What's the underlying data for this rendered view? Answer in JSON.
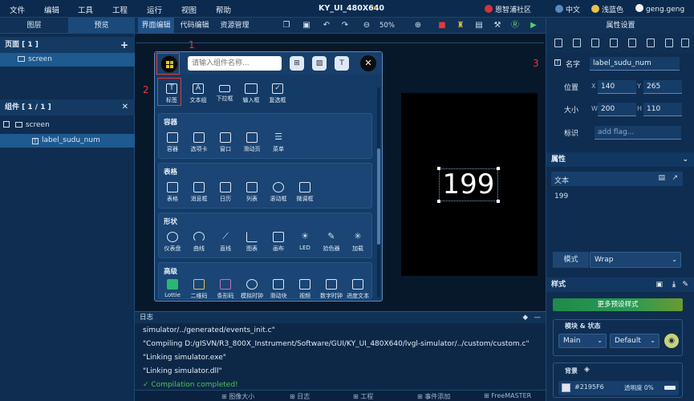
{
  "menu": {
    "items": [
      "文件",
      "编辑",
      "工具",
      "工程",
      "运行",
      "视图",
      "帮助"
    ],
    "title": "KY_UI_480X640",
    "community": "恩智浦社区",
    "language": "中文",
    "theme": "浅蓝色",
    "user": "geng.geng"
  },
  "toolbar": {
    "zoom": "50%",
    "tabs": [
      "界面编辑",
      "代码编辑",
      "资源管理"
    ]
  },
  "left": {
    "tabs": [
      "图层",
      "预览"
    ],
    "pages_header": "页面 [ 1 ]",
    "pages": [
      "screen"
    ],
    "components_header": "组件 [ 1 / 1 ]",
    "tree_root": "screen",
    "tree_child": "label_sudu_num"
  },
  "palette": {
    "search_placeholder": "请输入组件名称...",
    "top_widgets": [
      "标签",
      "文本组",
      "下拉框",
      "输入框",
      "复选框"
    ],
    "sections": [
      {
        "title": "容器",
        "items": [
          "容器",
          "选项卡",
          "窗口",
          "滑动页",
          "菜单"
        ]
      },
      {
        "title": "表格",
        "items": [
          "表格",
          "消息框",
          "日历",
          "列表",
          "滚动框",
          "微调框"
        ]
      },
      {
        "title": "形状",
        "items": [
          "仪表盘",
          "曲线",
          "直线",
          "图表",
          "画布",
          "LED",
          "拾色器",
          "加载"
        ]
      },
      {
        "title": "高级",
        "items": [
          "Lottie",
          "二维码",
          "条形码",
          "模拟时钟",
          "滑动块",
          "视频",
          "数字时钟",
          "进度文本"
        ]
      }
    ],
    "annotations": [
      "1",
      "2",
      "3"
    ]
  },
  "preview": {
    "label_text": "199"
  },
  "log": {
    "title": "日志",
    "lines": [
      "simulator/../generated/events_init.c\"",
      "\"Compiling D:/gISVN/R3_800X_Instrument/Software/GUI/KY_UI_480X640/lvgl-simulator/../custom/custom.c\"",
      "\"Linking simulator.exe\"",
      "\"Linking simulator.dll\"",
      "✓ Compilation completed!"
    ]
  },
  "status": {
    "items": [
      "图像大小",
      "日志",
      "工程",
      "事件添加",
      "FreeMASTER"
    ]
  },
  "properties": {
    "title": "属性设置",
    "name_label": "名字",
    "name_value": "label_sudu_num",
    "pos_label": "位置",
    "x": "140",
    "y": "265",
    "size_label": "大小",
    "w": "200",
    "h": "110",
    "flag_label": "标识",
    "flag_placeholder": "add flag...",
    "attr_header": "属性",
    "text_label": "文本",
    "text_value": "199",
    "mode_label": "模式",
    "mode_value": "Wrap",
    "style_header": "样式",
    "more_styles": "更多预设样式",
    "part_state": "模块 & 状态",
    "part_value": "Main",
    "state_value": "Default",
    "bg_label": "背景",
    "bg_color": "#2195F6",
    "opacity_label": "透明度 0%"
  },
  "colors": {
    "accent": "#2195F6",
    "annotation": "#e53a3a"
  }
}
